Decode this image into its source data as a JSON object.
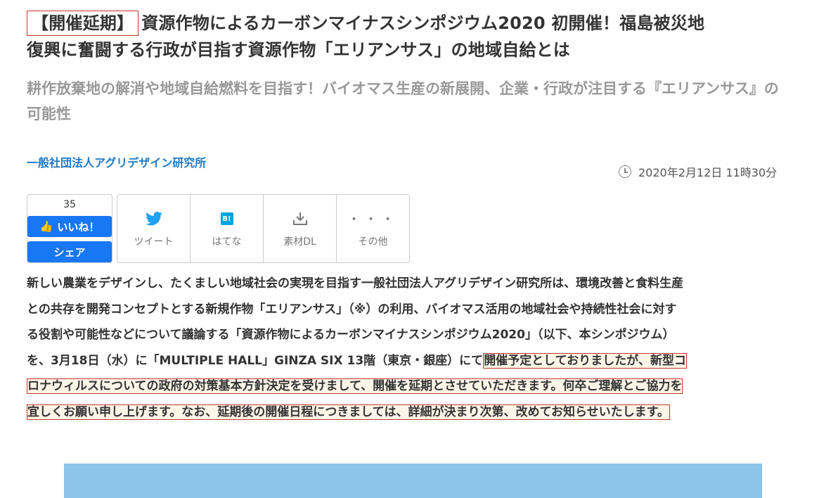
{
  "article": {
    "title_tag": "【開催延期】",
    "title_line1": "資源作物によるカーボンマイナスシンポジウム2020 初開催！福島被災地",
    "title_line2": "復興に奮闘する行政が目指す資源作物「エリアンサス」の地域自給とは",
    "subtitle": "耕作放棄地の解消や地域自給燃料を目指す！バイオマス生産の新展開、企業・行政が注目する『エリアンサス』の可能性",
    "company": "一般社団法人アグリデザイン研究所",
    "datetime": "2020年2月12日 11時30分"
  },
  "share": {
    "like_count": "35",
    "like_label": "いいね！",
    "share_label": "シェア",
    "tweet_label": "ツイート",
    "hatena_label": "はてな",
    "hatena_icon_text": "B!",
    "download_label": "素材DL",
    "more_label": "その他",
    "more_icon_text": "・・・"
  },
  "body": {
    "line1": "新しい農業をデザインし、たくましい地域社会の実現を目指す一般社団法人アグリデザイン研究所は、環境改善と食料生産",
    "line2": "との共存を開発コンセプトとする新規作物「エリアンサス」（※）の利用、バイオマス活用の地域社会や持続性社会に対す",
    "line3": "る役割や可能性などについて議論する「資源作物によるカーボンマイナスシンポジウム2020」（以下、本シンポジウム）",
    "line4_a": "を、3月18日（水）に「MULTIPLE HALL」GINZA SIX 13階（東京・銀座）にて",
    "line4_b": "開催予定としておりましたが、新型コ",
    "line5": "ロナウィルスについての政府の対策基本方針決定を受けまして、開催を延期とさせていただきます。何卒ご理解とご協力を",
    "line6": "宜しくお願い申し上げます。なお、延期後の開催日程につきましては、詳細が決まり次第、改めてお知らせいたします。"
  },
  "colors": {
    "accent_red": "#c0392b",
    "facebook_blue": "#1877f2",
    "twitter_blue": "#1da1f2",
    "hatena_blue": "#00a4de",
    "company_blue": "#1e7ac9"
  }
}
